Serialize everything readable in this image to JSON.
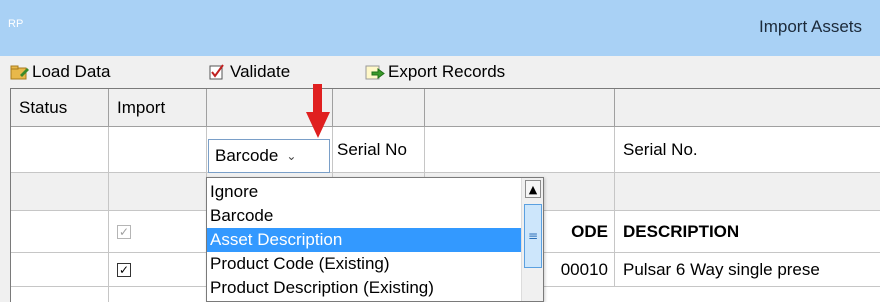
{
  "window": {
    "app_icon_text": "RP",
    "title": "Import Assets"
  },
  "toolbar": {
    "load": "Load Data",
    "validate": "Validate",
    "export": "Export Records"
  },
  "grid": {
    "headers": [
      "Status",
      "Import",
      "",
      "",
      "",
      ""
    ],
    "mapping_row": {
      "col4": "Serial No."
    },
    "serial_input": "Serial No",
    "data_header": {
      "code": "ODE",
      "description": "DESCRIPTION"
    },
    "data_row1": {
      "code": "00010",
      "description": "Pulsar 6 Way single prese"
    }
  },
  "combo": {
    "value": "Barcode",
    "arrow": "⌄"
  },
  "dropdown": {
    "options": [
      "Ignore",
      "Barcode",
      "Asset Description",
      "Product Code (Existing)",
      "Product Description (Existing)"
    ],
    "selected_index": 2
  },
  "colors": {
    "titlebar": "#a9d1f5",
    "selection": "#3399ff",
    "marker": "#e02020"
  }
}
